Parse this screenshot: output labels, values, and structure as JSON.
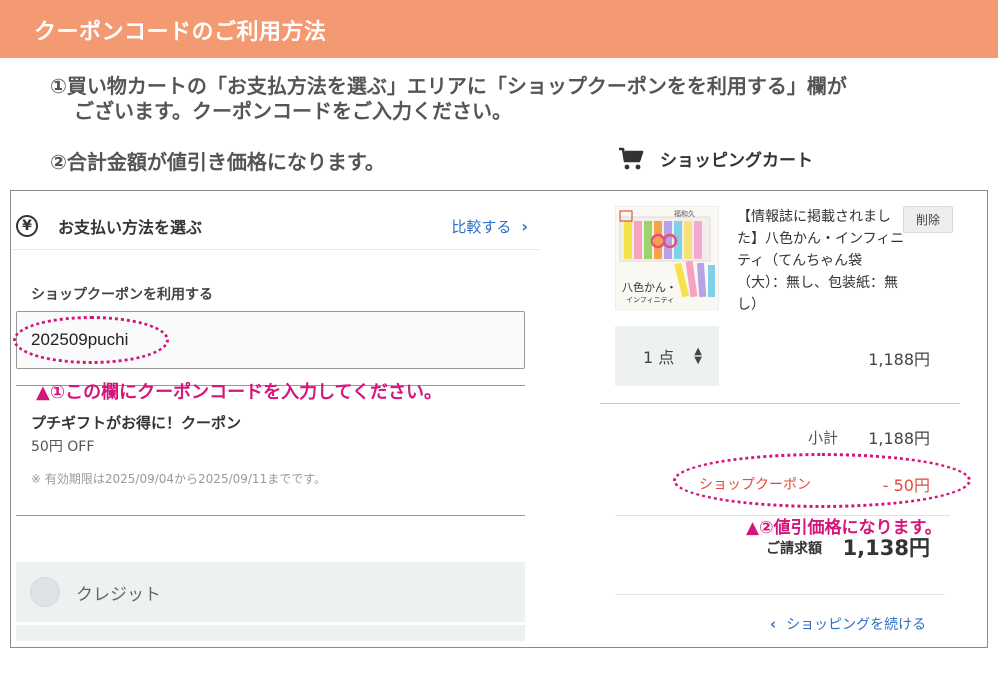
{
  "header": {
    "title": "クーポンコードのご利用方法"
  },
  "steps": {
    "step1_line1": "①買い物カートの「お支払方法を選ぶ」エリアに「ショップクーポンをを利用する」欄が",
    "step1_line2": "ございます。クーポンコードをご入力ください。",
    "step2": "②合計金額が値引き価格になります。"
  },
  "cart": {
    "heading": "ショッピングカート",
    "heading_icon": "shopping-cart-icon",
    "product": {
      "name": "【情報誌に掲載されました】八色かん・インフィニティ（てんちゃん袋（大）：無し、包装紙：無し）",
      "image_caption_1": "八色かん・",
      "image_caption_2": "インフィニティ",
      "image_tag": "福和久",
      "delete_label": "削除",
      "quantity": "1 点",
      "price": "1,188円"
    },
    "subtotal_label": "小計",
    "subtotal_value": "1,188円",
    "coupon_label": "ショップクーポン",
    "coupon_value": "- 50円",
    "note": "▲②値引価格になります。",
    "total_label": "ご請求額",
    "total_value": "1,138円",
    "continue_label": "ショッピングを続ける"
  },
  "payment": {
    "title": "お支払い方法を選ぶ",
    "title_icon": "yen-icon",
    "compare_label": "比較する",
    "coupon_field_label": "ショップクーポンを利用する",
    "coupon_code": "202509puchi",
    "note": "▲①この欄にクーポンコードを入力してください。",
    "coupon_name": "プチギフトがお得に！クーポン",
    "coupon_discount": "50円 OFF",
    "validity": "※ 有効期限は2025/09/04から2025/09/11までです。",
    "method_credit": "クレジット"
  },
  "colors": {
    "header_bg": "#f39a72",
    "annotation": "#d4157a",
    "link": "#2a6fc9",
    "coupon_red": "#e34a3d"
  }
}
